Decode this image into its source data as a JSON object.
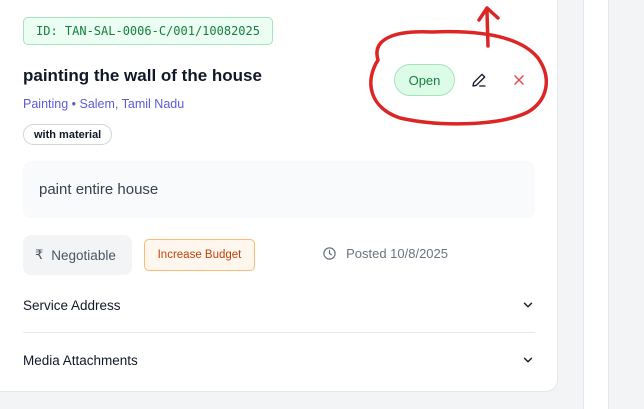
{
  "job": {
    "id_label": "ID: TAN-SAL-0006-C/001/10082025",
    "title": "painting the wall of the house",
    "subtitle": "Painting • Salem, Tamil Nadu",
    "material_tag": "with material",
    "status": "Open",
    "description": "paint entire house",
    "budget_symbol": "₹",
    "budget_label": "Negotiable",
    "increase_budget_label": "Increase Budget",
    "posted_label": "Posted 10/8/2025"
  },
  "sections": [
    {
      "label": "Service Address"
    },
    {
      "label": "Media Attachments"
    }
  ],
  "icons": {
    "edit": "pencil-icon",
    "close": "close-icon",
    "clock": "clock-icon",
    "chevron": "chevron-down-icon"
  },
  "colors": {
    "status_green": "#15803d",
    "status_bg": "#dcfce7",
    "accent_link": "#5b5bd6",
    "increase_orange": "#c2410c",
    "close_red": "#ef4444",
    "annotation_red": "#dc2626"
  }
}
